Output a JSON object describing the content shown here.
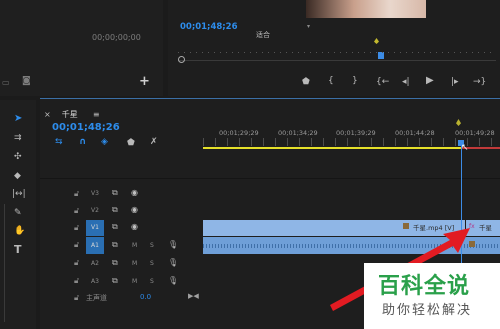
{
  "source_monitor": {
    "timecode": "00;00;00;00"
  },
  "program_monitor": {
    "timecode": "00;01;48;26",
    "fit_option": "适合",
    "controls": [
      "marker",
      "in-point",
      "out-point",
      "go-to-in",
      "step-back",
      "play",
      "step-forward",
      "go-to-out"
    ]
  },
  "timeline": {
    "close": "×",
    "title": "千星",
    "menu_icon": "≡",
    "timecode": "00;01;48;26",
    "ruler_labels": [
      "00;01;29;29",
      "00;01;34;29",
      "00;01;39;29",
      "00;01;44;28",
      "00;01;49;28"
    ],
    "tracks": [
      {
        "name": "V3",
        "type": "video"
      },
      {
        "name": "V2",
        "type": "video"
      },
      {
        "name": "V1",
        "type": "video",
        "active": true,
        "clip_label": "千星.mp4 [V]",
        "clip2_label": "千星"
      },
      {
        "name": "A1",
        "type": "audio",
        "active": true,
        "mute": "M",
        "solo": "S"
      },
      {
        "name": "A2",
        "type": "audio",
        "mute": "M",
        "solo": "S"
      },
      {
        "name": "A3",
        "type": "audio",
        "mute": "M",
        "solo": "S"
      }
    ],
    "master": {
      "label": "主声道",
      "value": "0.0"
    }
  },
  "watermark": {
    "title": "百科全说",
    "subtitle": "助你轻松解决"
  },
  "colors": {
    "accent": "#2d8ceb",
    "clip": "#8fb6e6",
    "audio_clip": "#6f9fd8",
    "playhead": "#3c8ce6",
    "worked_area": "#e5e02a",
    "arrow": "#e21b22"
  }
}
